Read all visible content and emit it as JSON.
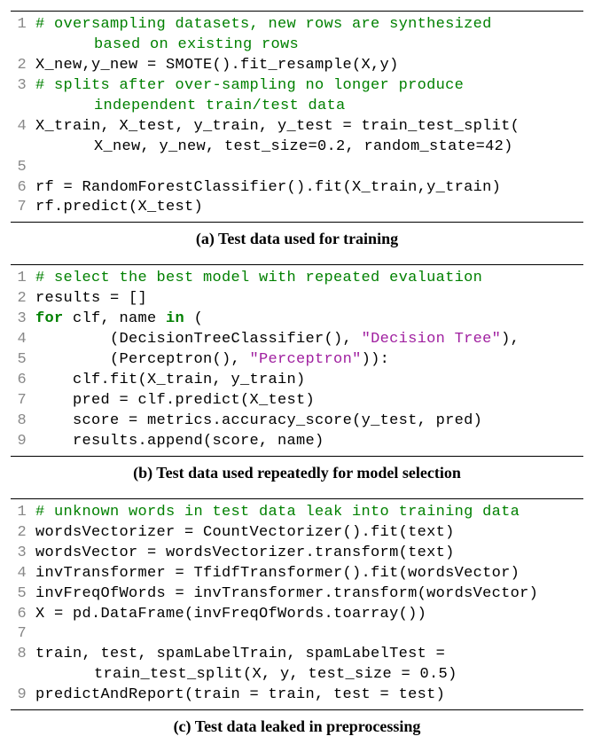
{
  "blocks": [
    {
      "caption": "(a) Test data used for training",
      "lines": [
        {
          "n": "1",
          "segs": [
            {
              "cls": "comment",
              "t": "# oversampling datasets, new rows are synthesized"
            }
          ],
          "cont": [
            {
              "cls": "comment",
              "t": "based on existing rows"
            }
          ]
        },
        {
          "n": "2",
          "segs": [
            {
              "t": "X_new,y_new = SMOTE().fit_resample(X,y)"
            }
          ]
        },
        {
          "n": "3",
          "segs": [
            {
              "cls": "comment",
              "t": "# splits after over-sampling no longer produce"
            }
          ],
          "cont": [
            {
              "cls": "comment",
              "t": "independent train/test data"
            }
          ]
        },
        {
          "n": "4",
          "segs": [
            {
              "t": "X_train, X_test, y_train, y_test = train_test_split("
            }
          ],
          "cont": [
            {
              "t": "X_new, y_new, test_size=0.2, random_state=42)"
            }
          ]
        },
        {
          "n": "5",
          "segs": [
            {
              "t": " "
            }
          ]
        },
        {
          "n": "6",
          "segs": [
            {
              "t": "rf = RandomForestClassifier().fit(X_train,y_train)"
            }
          ]
        },
        {
          "n": "7",
          "segs": [
            {
              "t": "rf.predict(X_test)"
            }
          ]
        }
      ]
    },
    {
      "caption": "(b) Test data used repeatedly for model selection",
      "lines": [
        {
          "n": "1",
          "segs": [
            {
              "cls": "comment",
              "t": "# select the best model with repeated evaluation"
            }
          ]
        },
        {
          "n": "2",
          "segs": [
            {
              "t": "results = []"
            }
          ]
        },
        {
          "n": "3",
          "segs": [
            {
              "cls": "keyword",
              "t": "for"
            },
            {
              "t": " clf, name "
            },
            {
              "cls": "keyword",
              "t": "in"
            },
            {
              "t": " ("
            }
          ]
        },
        {
          "n": "4",
          "segs": [
            {
              "t": "        (DecisionTreeClassifier(), "
            },
            {
              "cls": "string",
              "t": "\"Decision Tree\""
            },
            {
              "t": "),"
            }
          ]
        },
        {
          "n": "5",
          "segs": [
            {
              "t": "        (Perceptron(), "
            },
            {
              "cls": "string",
              "t": "\"Perceptron\""
            },
            {
              "t": ")):"
            }
          ]
        },
        {
          "n": "6",
          "segs": [
            {
              "t": "    clf.fit(X_train, y_train)"
            }
          ]
        },
        {
          "n": "7",
          "segs": [
            {
              "t": "    pred = clf.predict(X_test)"
            }
          ]
        },
        {
          "n": "8",
          "segs": [
            {
              "t": "    score = metrics.accuracy_score(y_test, pred)"
            }
          ]
        },
        {
          "n": "9",
          "segs": [
            {
              "t": "    results.append(score, name)"
            }
          ]
        }
      ]
    },
    {
      "caption": "(c) Test data leaked in preprocessing",
      "lines": [
        {
          "n": "1",
          "segs": [
            {
              "cls": "comment",
              "t": "# unknown words in test data leak into training data"
            }
          ]
        },
        {
          "n": "2",
          "segs": [
            {
              "t": "wordsVectorizer = CountVectorizer().fit(text)"
            }
          ]
        },
        {
          "n": "3",
          "segs": [
            {
              "t": "wordsVector = wordsVectorizer.transform(text)"
            }
          ]
        },
        {
          "n": "4",
          "segs": [
            {
              "t": "invTransformer = TfidfTransformer().fit(wordsVector)"
            }
          ]
        },
        {
          "n": "5",
          "segs": [
            {
              "t": "invFreqOfWords = invTransformer.transform(wordsVector)"
            }
          ]
        },
        {
          "n": "6",
          "segs": [
            {
              "t": "X = pd.DataFrame(invFreqOfWords.toarray())"
            }
          ]
        },
        {
          "n": "7",
          "segs": [
            {
              "t": " "
            }
          ]
        },
        {
          "n": "8",
          "segs": [
            {
              "t": "train, test, spamLabelTrain, spamLabelTest ="
            }
          ],
          "cont": [
            {
              "t": "train_test_split(X, y, test_size = 0.5)"
            }
          ]
        },
        {
          "n": "9",
          "segs": [
            {
              "t": "predictAndReport(train = train, test = test)"
            }
          ]
        }
      ]
    }
  ]
}
